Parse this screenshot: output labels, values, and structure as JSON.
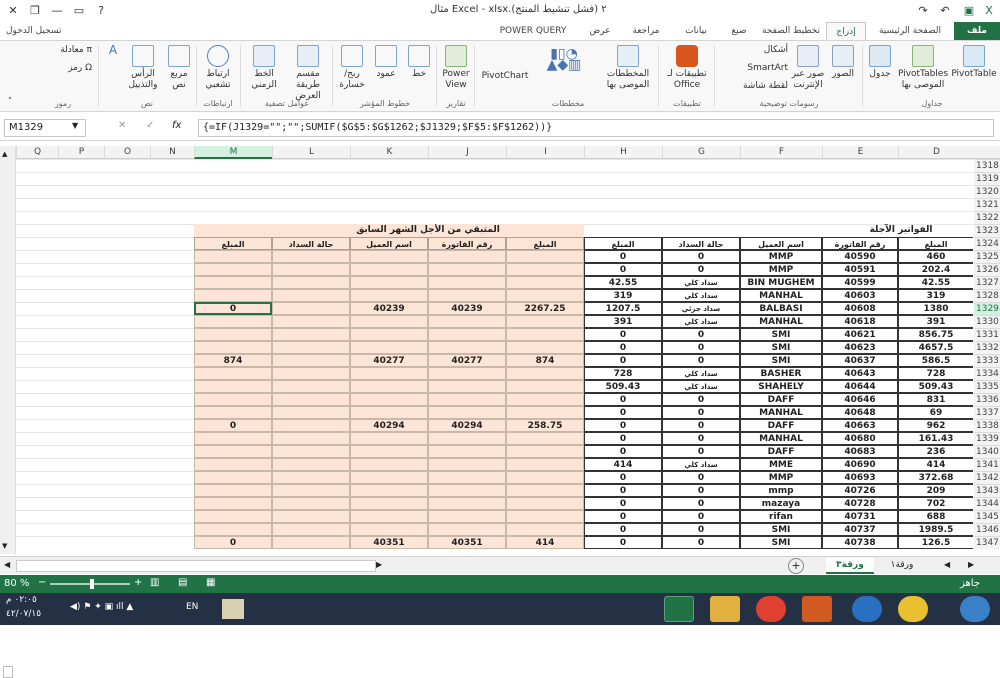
{
  "window": {
    "title": "مثال Excel - xlsx.٢ (فشل تنشيط المنتج)",
    "signin": "تسجيل الدخول",
    "help": "?"
  },
  "tabs": [
    "ملف",
    "الصفحة الرئيسية",
    "إدراج",
    "تخطيط الصفحة",
    "صيغ",
    "بيانات",
    "مراجعة",
    "عرض",
    "POWER QUERY"
  ],
  "ribbon": {
    "groups": [
      "جداول",
      "رسومات توضيحية",
      "تطبيقات",
      "مخططات",
      "تقارير",
      "خطوط المؤشر",
      "عوامل تصفية",
      "ارتباطات",
      "نص",
      "رموز"
    ],
    "items": {
      "pivottable": "PivotTable",
      "recommended_pivot": "PivotTables الموصى بها",
      "table": "جدول",
      "pictures": "الصور",
      "online_pictures": "صور عبر الإنترنت",
      "shapes": "أشكال",
      "smartart": "SmartArt",
      "screenshot": "لقطة شاشة",
      "office_apps": "تطبيقات لـ Office",
      "recommended_charts": "المخططات الموصى بها",
      "pivotchart": "PivotChart",
      "power_view": "Power View",
      "line": "خط",
      "column": "عمود",
      "winloss": "ربح/خسارة",
      "slicer": "مقسم طريقة العرض",
      "timeline": "الخط الزمني",
      "hyperlink": "ارتباط تشعبي",
      "textbox": "مربع نص",
      "header_footer": "الرأس والتذييل",
      "equation": "معادلة",
      "symbol": "رمز"
    }
  },
  "formula_bar": {
    "name_box": "M1329",
    "formula": "{=IF(J1329=\"\";\"\";SUMIF($G$5:$G$1262;$J1329;$F$5:$F$1262))}"
  },
  "columns": [
    "D",
    "E",
    "F",
    "G",
    "H",
    "I",
    "J",
    "K",
    "L",
    "M",
    "N",
    "O",
    "P",
    "Q"
  ],
  "rows": [
    "1318",
    "1319",
    "1320",
    "1321",
    "1322",
    "1323",
    "1324",
    "1325",
    "1326",
    "1327",
    "1328",
    "1329",
    "1330",
    "1331",
    "1332",
    "1333",
    "1334",
    "1335",
    "1336",
    "1337",
    "1338",
    "1339",
    "1340",
    "1341",
    "1342",
    "1343",
    "1344",
    "1345",
    "1346",
    "1347"
  ],
  "left_table": {
    "title": "الفواتير الآجلة",
    "headers": [
      "المبلغ",
      "رقم الفاتورة",
      "اسم العميل",
      "حالة السداد",
      "المبلغ"
    ],
    "rows": [
      [
        "460",
        "40590",
        "MMP",
        "0",
        "0"
      ],
      [
        "202.4",
        "40591",
        "MMP",
        "0",
        "0"
      ],
      [
        "42.55",
        "40599",
        "BIN MUGHEM",
        "سداد كلي",
        "42.55"
      ],
      [
        "319",
        "40603",
        "MANHAL",
        "سداد كلي",
        "319"
      ],
      [
        "1380",
        "40608",
        "BALBASI",
        "سداد جزئي",
        "1207.5"
      ],
      [
        "391",
        "40618",
        "MANHAL",
        "سداد كلي",
        "391"
      ],
      [
        "856.75",
        "40621",
        "SMI",
        "0",
        "0"
      ],
      [
        "4657.5",
        "40623",
        "SMI",
        "0",
        "0"
      ],
      [
        "586.5",
        "40637",
        "SMI",
        "0",
        "0"
      ],
      [
        "728",
        "40643",
        "BASHER",
        "سداد كلي",
        "728"
      ],
      [
        "509.43",
        "40644",
        "SHAHELY",
        "سداد كلي",
        "509.43"
      ],
      [
        "831",
        "40646",
        "DAFF",
        "0",
        "0"
      ],
      [
        "69",
        "40648",
        "MANHAL",
        "0",
        "0"
      ],
      [
        "962",
        "40663",
        "DAFF",
        "0",
        "0"
      ],
      [
        "161.43",
        "40680",
        "MANHAL",
        "0",
        "0"
      ],
      [
        "236",
        "40683",
        "DAFF",
        "0",
        "0"
      ],
      [
        "414",
        "40690",
        "MME",
        "سداد كلي",
        "414"
      ],
      [
        "372.68",
        "40693",
        "MMP",
        "0",
        "0"
      ],
      [
        "209",
        "40726",
        "mmp",
        "0",
        "0"
      ],
      [
        "702",
        "40728",
        "mazaya",
        "0",
        "0"
      ],
      [
        "688",
        "40731",
        "rifan",
        "0",
        "0"
      ],
      [
        "1989.5",
        "40737",
        "SMI",
        "0",
        "0"
      ],
      [
        "126.5",
        "40738",
        "SMI",
        "0",
        "0"
      ]
    ]
  },
  "right_table": {
    "title": "المتبقي من الأجل الشهر السابق",
    "headers": [
      "المبلغ",
      "رقم الفاتورة",
      "اسم العميل",
      "حالة السداد",
      "المبلغ"
    ],
    "rows": [
      [
        "",
        "",
        "",
        "",
        ""
      ],
      [
        "",
        "",
        "",
        "",
        ""
      ],
      [
        "",
        "",
        "",
        "",
        ""
      ],
      [
        "",
        "",
        "",
        "",
        ""
      ],
      [
        "2267.25",
        "40239",
        "40239",
        "",
        "0"
      ],
      [
        "",
        "",
        "",
        "",
        ""
      ],
      [
        "",
        "",
        "",
        "",
        ""
      ],
      [
        "",
        "",
        "",
        "",
        ""
      ],
      [
        "874",
        "40277",
        "40277",
        "",
        "874"
      ],
      [
        "",
        "",
        "",
        "",
        ""
      ],
      [
        "",
        "",
        "",
        "",
        ""
      ],
      [
        "",
        "",
        "",
        "",
        ""
      ],
      [
        "",
        "",
        "",
        "",
        ""
      ],
      [
        "258.75",
        "40294",
        "40294",
        "",
        "0"
      ],
      [
        "",
        "",
        "",
        "",
        ""
      ],
      [
        "",
        "",
        "",
        "",
        ""
      ],
      [
        "",
        "",
        "",
        "",
        ""
      ],
      [
        "",
        "",
        "",
        "",
        ""
      ],
      [
        "",
        "",
        "",
        "",
        ""
      ],
      [
        "",
        "",
        "",
        "",
        ""
      ],
      [
        "",
        "",
        "",
        "",
        ""
      ],
      [
        "",
        "",
        "",
        "",
        ""
      ],
      [
        "414",
        "40351",
        "40351",
        "",
        "0"
      ]
    ]
  },
  "sheets": [
    "ورقة١",
    "ورقة٣"
  ],
  "status": {
    "left": "جاهز",
    "zoom": "80 %"
  },
  "taskbar": {
    "time": "٠٢:٠٥ م",
    "date": "٤٢/٠٧/١٥",
    "lang": "EN"
  },
  "colors": {
    "excel_green": "#217346",
    "peach": "#fce4d6"
  }
}
